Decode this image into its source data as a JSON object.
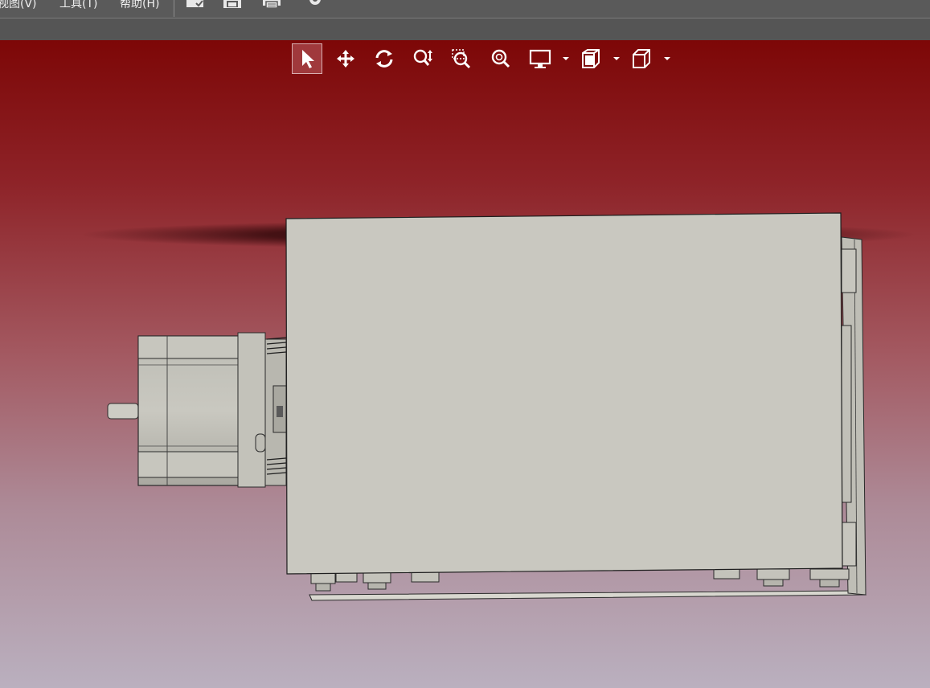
{
  "menubar": {
    "items": [
      {
        "label": "视图(V)"
      },
      {
        "label": "工具(T)"
      },
      {
        "label": "帮助(H)"
      }
    ],
    "icons": [
      "open-icon",
      "save-icon",
      "print-icon",
      "settings-icon"
    ]
  },
  "view_toolbar": {
    "tools": [
      {
        "name": "select-tool",
        "icon": "cursor-icon",
        "active": true
      },
      {
        "name": "pan-tool",
        "icon": "move-icon",
        "active": false
      },
      {
        "name": "rotate-tool",
        "icon": "rotate-icon",
        "active": false
      },
      {
        "name": "zoom-tool",
        "icon": "zoom-updown-icon",
        "active": false
      },
      {
        "name": "zoom-window-tool",
        "icon": "zoom-window-icon",
        "active": false
      },
      {
        "name": "zoom-fit-tool",
        "icon": "zoom-fit-icon",
        "active": false
      },
      {
        "name": "display-style-dropdown",
        "icon": "monitor-icon",
        "dropdown": true
      },
      {
        "name": "section-view-dropdown",
        "icon": "section-icon",
        "dropdown": true
      },
      {
        "name": "view-orientation-dropdown",
        "icon": "cube-icon",
        "dropdown": true
      }
    ]
  },
  "viewport": {
    "background_top": "#7d0707",
    "background_bottom": "#bab0bf",
    "model": "motor-and-housing-assembly",
    "body_color": "#c9c8c0",
    "edge_color": "#2a2a2a"
  }
}
